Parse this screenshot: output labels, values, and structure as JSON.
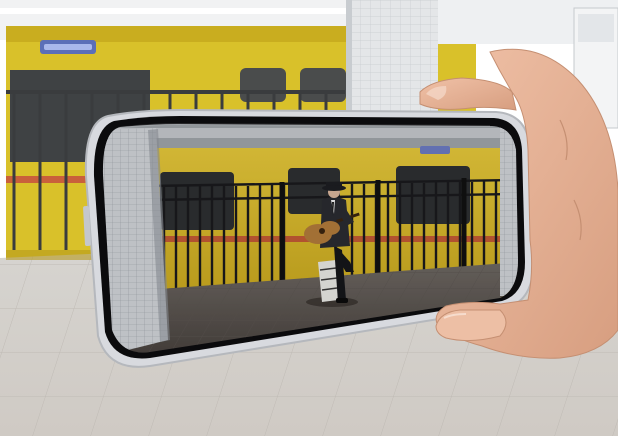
{
  "photo": {
    "subject": "phone-held-in-landscape-showing-ar-scene",
    "background": {
      "train_color": "#d9c12a",
      "wall_color": "#e9ecef",
      "floor_color": "#d7d5d1",
      "stripe_color": "#c9603b"
    },
    "phone": {
      "frame_color": "#d8dadf",
      "bezel_color": "#0b0b0d"
    },
    "screen": {
      "train_color": "#e3c63a",
      "railing_color": "#1a1a1d",
      "floor_color": "#6d6762",
      "pillar_color": "#c9ccd0"
    },
    "figure": {
      "label": "guitarist-in-hat-and-suit"
    },
    "hand": {
      "skin_color": "#e7b69c"
    }
  }
}
